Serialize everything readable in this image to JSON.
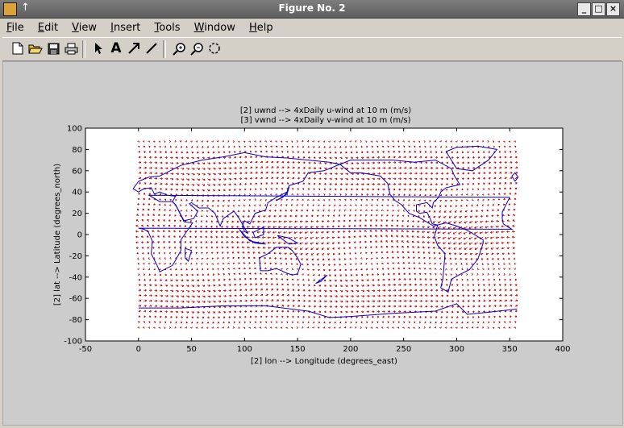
{
  "window": {
    "title": "Figure No. 2",
    "pin_glyph": "↑",
    "controls": {
      "minimize": "_",
      "maximize": "□",
      "close": "×"
    }
  },
  "menu": [
    {
      "first": "F",
      "rest": "ile"
    },
    {
      "first": "E",
      "rest": "dit"
    },
    {
      "first": "V",
      "rest": "iew"
    },
    {
      "first": "I",
      "rest": "nsert"
    },
    {
      "first": "T",
      "rest": "ools"
    },
    {
      "first": "W",
      "rest": "indow"
    },
    {
      "first": "H",
      "rest": "elp"
    }
  ],
  "toolbar": {
    "icons": [
      "new-file-icon",
      "open-folder-icon",
      "save-icon",
      "print-icon",
      "arrow-select-icon",
      "text-A-icon",
      "arrow-draw-icon",
      "line-draw-icon",
      "zoom-in-icon",
      "zoom-out-icon",
      "rotate-icon"
    ],
    "text_tool_label": "A"
  },
  "colors": {
    "quiver": "#cc0000",
    "coast": "#0000cc",
    "background": "#cccccc"
  },
  "chart_data": {
    "type": "quiver",
    "title_line1": "[2] uwnd --> 4xDaily u-wind at 10 m (m/s)",
    "title_line2": "[3] vwnd --> 4xDaily v-wind at 10 m (m/s)",
    "xlabel": "[2]  lon --> Longitude (degrees_east)",
    "ylabel": "[2]  lat --> Latitude (degrees_north)",
    "xlim": [
      -50,
      400
    ],
    "ylim": [
      -100,
      100
    ],
    "xticks": [
      -50,
      0,
      50,
      100,
      150,
      200,
      250,
      300,
      350,
      400
    ],
    "yticks": [
      100,
      80,
      60,
      40,
      20,
      0,
      -20,
      -40,
      -60,
      -80,
      -100
    ],
    "grid": false,
    "series": [
      {
        "kind": "wind vectors",
        "color": "#cc0000",
        "lon_range": [
          0,
          357.5
        ],
        "lat_range": [
          -90,
          90
        ]
      },
      {
        "kind": "coastlines",
        "color": "#0000cc"
      }
    ]
  }
}
